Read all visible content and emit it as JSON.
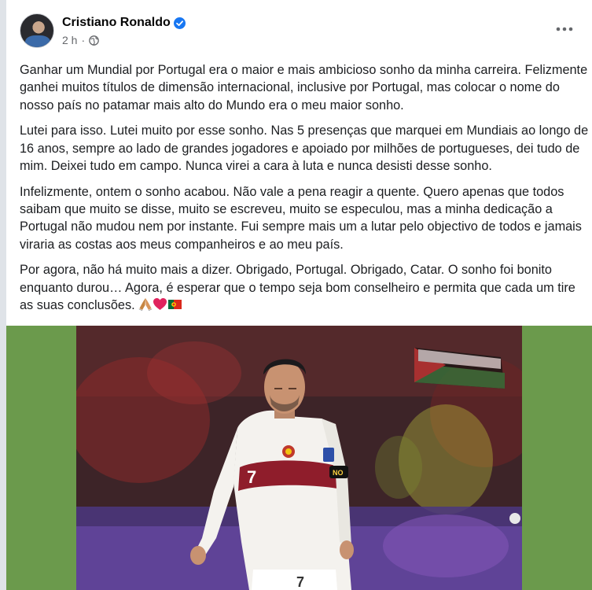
{
  "post": {
    "author": "Cristiano Ronaldo",
    "time": "2 h",
    "paragraphs": [
      "Ganhar um Mundial por Portugal era o maior e mais ambicioso sonho da minha carreira. Felizmente ganhei muitos títulos de dimensão internacional, inclusive por Portugal, mas colocar o nome do nosso país no patamar mais alto do Mundo era o meu maior sonho.",
      "Lutei para isso. Lutei muito por esse sonho. Nas 5 presenças que marquei em Mundiais ao longo de 16 anos, sempre ao lado de grandes jogadores e apoiado por milhões de portugueses, dei tudo de mim. Deixei tudo em campo. Nunca virei a cara à luta e nunca desisti desse sonho.",
      "Infelizmente, ontem o sonho acabou. Não vale a pena reagir a quente. Quero apenas que todos saibam que muito se disse, muito se escreveu, muito se especulou, mas a minha dedicação a Portugal não mudou nem por instante. Fui sempre mais um a lutar pelo objectivo de todos e jamais viraria as costas aos meus companheiros e ao meu país.",
      "Por agora, não há muito mais a dizer. Obrigado, Portugal. Obrigado, Catar. O sonho foi bonito enquanto durou… Agora, é esperar que o tempo seja bom conselheiro e permita que cada um tire as suas conclusões."
    ],
    "shirt_number": "7",
    "armband_text": "NO"
  },
  "icons": {
    "verified": "verified-badge-icon",
    "privacy": "globe-icon",
    "more": "more-options-icon",
    "emojis": [
      "folded-hands-emoji",
      "red-heart-emoji",
      "portugal-flag-emoji"
    ]
  },
  "colors": {
    "verified_blue": "#1877f2",
    "meta_gray": "#65676b",
    "media_bg": "#6b9a4c"
  }
}
